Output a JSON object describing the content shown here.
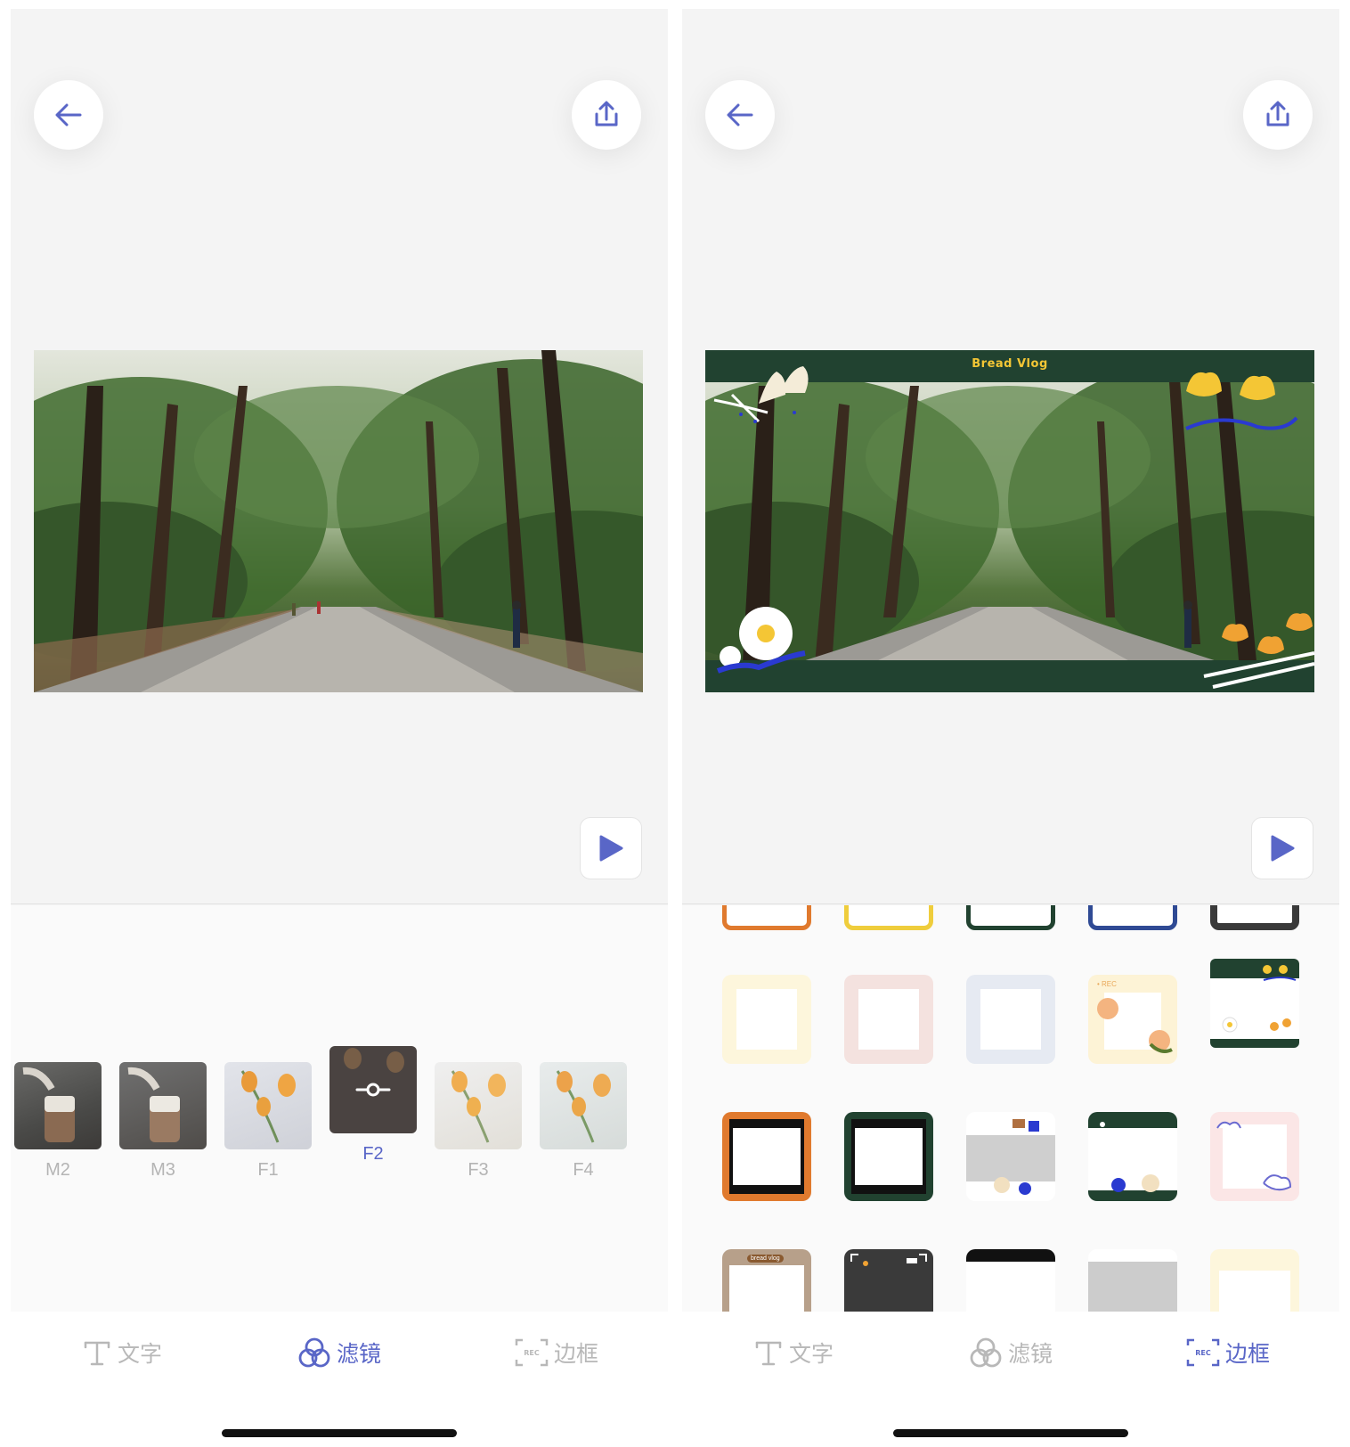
{
  "colors": {
    "accent": "#5966c7",
    "inactive": "#b8b8b8",
    "frame_green": "#214230",
    "frame_title": "#f4c635"
  },
  "icons": {
    "back": "arrow-left-icon",
    "share": "share-icon",
    "play": "play-icon",
    "text": "text-icon",
    "filter": "filter-icon",
    "frame": "rec-frame-icon",
    "slider": "slider-icon"
  },
  "left": {
    "filters": [
      {
        "label": "M2",
        "selected": false
      },
      {
        "label": "M3",
        "selected": false
      },
      {
        "label": "F1",
        "selected": false
      },
      {
        "label": "F2",
        "selected": true
      },
      {
        "label": "F3",
        "selected": false
      },
      {
        "label": "F4",
        "selected": false
      }
    ],
    "tabs": [
      {
        "label": "文字",
        "active": false
      },
      {
        "label": "滤镜",
        "active": true
      },
      {
        "label": "边框",
        "active": false
      }
    ]
  },
  "right": {
    "frame_title": "Bread Vlog",
    "frame_tag_rec": "• REC",
    "frame_tag_bread": "bread vlog",
    "tabs": [
      {
        "label": "文字",
        "active": false
      },
      {
        "label": "滤镜",
        "active": false
      },
      {
        "label": "边框",
        "active": true
      }
    ]
  }
}
